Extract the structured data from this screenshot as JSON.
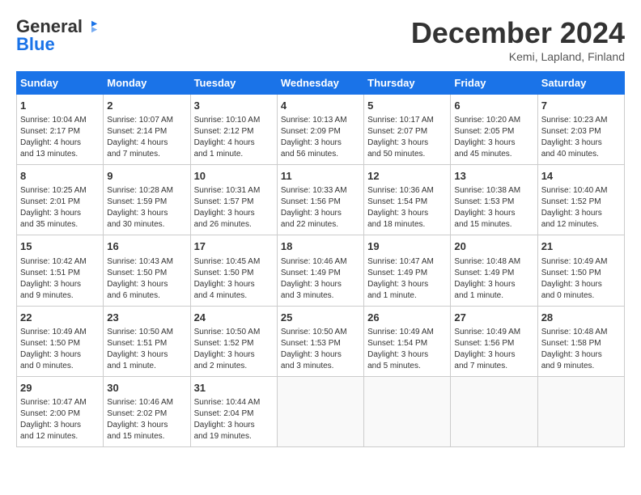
{
  "header": {
    "logo_general": "General",
    "logo_blue": "Blue",
    "month_title": "December 2024",
    "location": "Kemi, Lapland, Finland"
  },
  "days_of_week": [
    "Sunday",
    "Monday",
    "Tuesday",
    "Wednesday",
    "Thursday",
    "Friday",
    "Saturday"
  ],
  "weeks": [
    [
      {
        "day": "1",
        "info": "Sunrise: 10:04 AM\nSunset: 2:17 PM\nDaylight: 4 hours\nand 13 minutes."
      },
      {
        "day": "2",
        "info": "Sunrise: 10:07 AM\nSunset: 2:14 PM\nDaylight: 4 hours\nand 7 minutes."
      },
      {
        "day": "3",
        "info": "Sunrise: 10:10 AM\nSunset: 2:12 PM\nDaylight: 4 hours\nand 1 minute."
      },
      {
        "day": "4",
        "info": "Sunrise: 10:13 AM\nSunset: 2:09 PM\nDaylight: 3 hours\nand 56 minutes."
      },
      {
        "day": "5",
        "info": "Sunrise: 10:17 AM\nSunset: 2:07 PM\nDaylight: 3 hours\nand 50 minutes."
      },
      {
        "day": "6",
        "info": "Sunrise: 10:20 AM\nSunset: 2:05 PM\nDaylight: 3 hours\nand 45 minutes."
      },
      {
        "day": "7",
        "info": "Sunrise: 10:23 AM\nSunset: 2:03 PM\nDaylight: 3 hours\nand 40 minutes."
      }
    ],
    [
      {
        "day": "8",
        "info": "Sunrise: 10:25 AM\nSunset: 2:01 PM\nDaylight: 3 hours\nand 35 minutes."
      },
      {
        "day": "9",
        "info": "Sunrise: 10:28 AM\nSunset: 1:59 PM\nDaylight: 3 hours\nand 30 minutes."
      },
      {
        "day": "10",
        "info": "Sunrise: 10:31 AM\nSunset: 1:57 PM\nDaylight: 3 hours\nand 26 minutes."
      },
      {
        "day": "11",
        "info": "Sunrise: 10:33 AM\nSunset: 1:56 PM\nDaylight: 3 hours\nand 22 minutes."
      },
      {
        "day": "12",
        "info": "Sunrise: 10:36 AM\nSunset: 1:54 PM\nDaylight: 3 hours\nand 18 minutes."
      },
      {
        "day": "13",
        "info": "Sunrise: 10:38 AM\nSunset: 1:53 PM\nDaylight: 3 hours\nand 15 minutes."
      },
      {
        "day": "14",
        "info": "Sunrise: 10:40 AM\nSunset: 1:52 PM\nDaylight: 3 hours\nand 12 minutes."
      }
    ],
    [
      {
        "day": "15",
        "info": "Sunrise: 10:42 AM\nSunset: 1:51 PM\nDaylight: 3 hours\nand 9 minutes."
      },
      {
        "day": "16",
        "info": "Sunrise: 10:43 AM\nSunset: 1:50 PM\nDaylight: 3 hours\nand 6 minutes."
      },
      {
        "day": "17",
        "info": "Sunrise: 10:45 AM\nSunset: 1:50 PM\nDaylight: 3 hours\nand 4 minutes."
      },
      {
        "day": "18",
        "info": "Sunrise: 10:46 AM\nSunset: 1:49 PM\nDaylight: 3 hours\nand 3 minutes."
      },
      {
        "day": "19",
        "info": "Sunrise: 10:47 AM\nSunset: 1:49 PM\nDaylight: 3 hours\nand 1 minute."
      },
      {
        "day": "20",
        "info": "Sunrise: 10:48 AM\nSunset: 1:49 PM\nDaylight: 3 hours\nand 1 minute."
      },
      {
        "day": "21",
        "info": "Sunrise: 10:49 AM\nSunset: 1:50 PM\nDaylight: 3 hours\nand 0 minutes."
      }
    ],
    [
      {
        "day": "22",
        "info": "Sunrise: 10:49 AM\nSunset: 1:50 PM\nDaylight: 3 hours\nand 0 minutes."
      },
      {
        "day": "23",
        "info": "Sunrise: 10:50 AM\nSunset: 1:51 PM\nDaylight: 3 hours\nand 1 minute."
      },
      {
        "day": "24",
        "info": "Sunrise: 10:50 AM\nSunset: 1:52 PM\nDaylight: 3 hours\nand 2 minutes."
      },
      {
        "day": "25",
        "info": "Sunrise: 10:50 AM\nSunset: 1:53 PM\nDaylight: 3 hours\nand 3 minutes."
      },
      {
        "day": "26",
        "info": "Sunrise: 10:49 AM\nSunset: 1:54 PM\nDaylight: 3 hours\nand 5 minutes."
      },
      {
        "day": "27",
        "info": "Sunrise: 10:49 AM\nSunset: 1:56 PM\nDaylight: 3 hours\nand 7 minutes."
      },
      {
        "day": "28",
        "info": "Sunrise: 10:48 AM\nSunset: 1:58 PM\nDaylight: 3 hours\nand 9 minutes."
      }
    ],
    [
      {
        "day": "29",
        "info": "Sunrise: 10:47 AM\nSunset: 2:00 PM\nDaylight: 3 hours\nand 12 minutes."
      },
      {
        "day": "30",
        "info": "Sunrise: 10:46 AM\nSunset: 2:02 PM\nDaylight: 3 hours\nand 15 minutes."
      },
      {
        "day": "31",
        "info": "Sunrise: 10:44 AM\nSunset: 2:04 PM\nDaylight: 3 hours\nand 19 minutes."
      },
      null,
      null,
      null,
      null
    ]
  ]
}
